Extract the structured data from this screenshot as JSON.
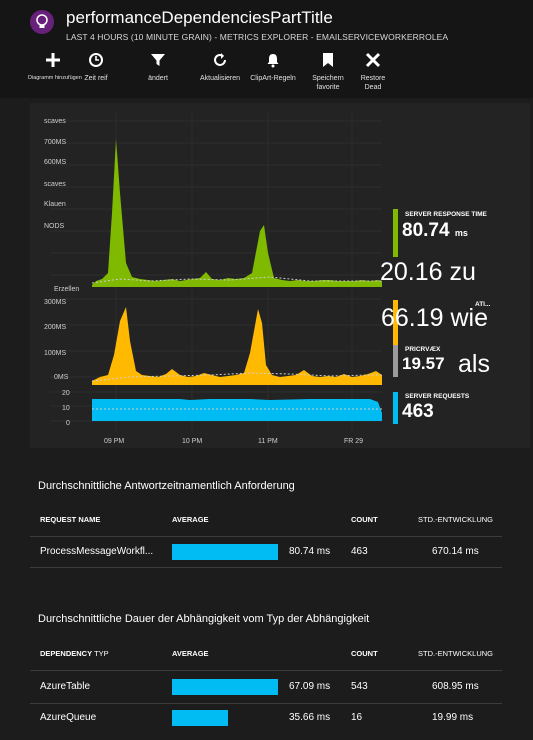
{
  "header": {
    "title": "performanceDependenciesPartTitle",
    "subtitle": "LAST 4 HOURS (10 MINUTE GRAIN) - METRICS EXPLORER - EMAILSERVICEWORKERROLEA",
    "toolbar": [
      {
        "label": "Diagramm hinzufügen",
        "icon": "plus-icon"
      },
      {
        "label": "Zeit reif",
        "icon": "clock-icon"
      },
      {
        "label": "ändert",
        "icon": "filter-icon"
      },
      {
        "label": "Aktualisieren",
        "icon": "refresh-icon"
      },
      {
        "label": "ClipArt-Regeln",
        "icon": "bell-icon"
      },
      {
        "label": "Speichern favorite",
        "icon": "bookmark-icon"
      },
      {
        "label": "Restore Dead",
        "icon": "close-icon"
      }
    ]
  },
  "chart": {
    "top_axis_labels": [
      "scaves",
      "700MS",
      "600MS",
      "scaves",
      "Klauen",
      "NODS",
      "Erzellen"
    ],
    "mid_axis_labels": [
      "300MS",
      "200MS",
      "100MS",
      "0MS"
    ],
    "bottom_axis_labels": [
      "20",
      "10",
      "0"
    ],
    "time_labels": [
      "09 PM",
      "10 PM",
      "11 PM",
      "FR 29"
    ],
    "colors": {
      "green": "#7fba00",
      "orange": "#ffb900",
      "blue": "#00bcf2",
      "gray": "#9b9b9b"
    }
  },
  "metrics": {
    "server_response_label": "SERVER RESPONSE TIME",
    "server_response_value": "80.74",
    "server_response_unit": "ms",
    "overlay_1": "20.16 zu",
    "second_label": "ATI...",
    "overlay_2": "66.19 wie",
    "third_label": "PRICRVÆX",
    "third_value": "19.57",
    "overlay_3": "als",
    "requests_label": "SERVER REQUESTS",
    "requests_value": "463"
  },
  "table1": {
    "title": "Durchschnittliche Antwortzeitnamentlich Anforderung",
    "col_name": "REQUEST NAME",
    "col_avg": "AVERAGE",
    "col_count": "COUNT",
    "col_std": "STD.-ENTWICKLUNG",
    "rows": [
      {
        "name": "ProcessMessageWorkfl...",
        "average": "80.74 ms",
        "fraction": 1.0,
        "count": "463",
        "std": "670.14 ms"
      }
    ]
  },
  "table2": {
    "title": "Durchschnittliche Dauer der Abhängigkeit vom Typ der Abhängigkeit",
    "col_name": "DEPENDENCY",
    "col_name_suffix": "TYP",
    "col_avg": "AVERAGE",
    "col_count": "COUNT",
    "col_std": "STD.-ENTWICKLUNG",
    "rows": [
      {
        "name": "AzureTable",
        "average": "67.09 ms",
        "fraction": 1.0,
        "count": "543",
        "std": "608.95 ms"
      },
      {
        "name": "AzureQueue",
        "average": "35.66 ms",
        "fraction": 0.53,
        "count": "16",
        "std": "19.99 ms"
      }
    ]
  }
}
